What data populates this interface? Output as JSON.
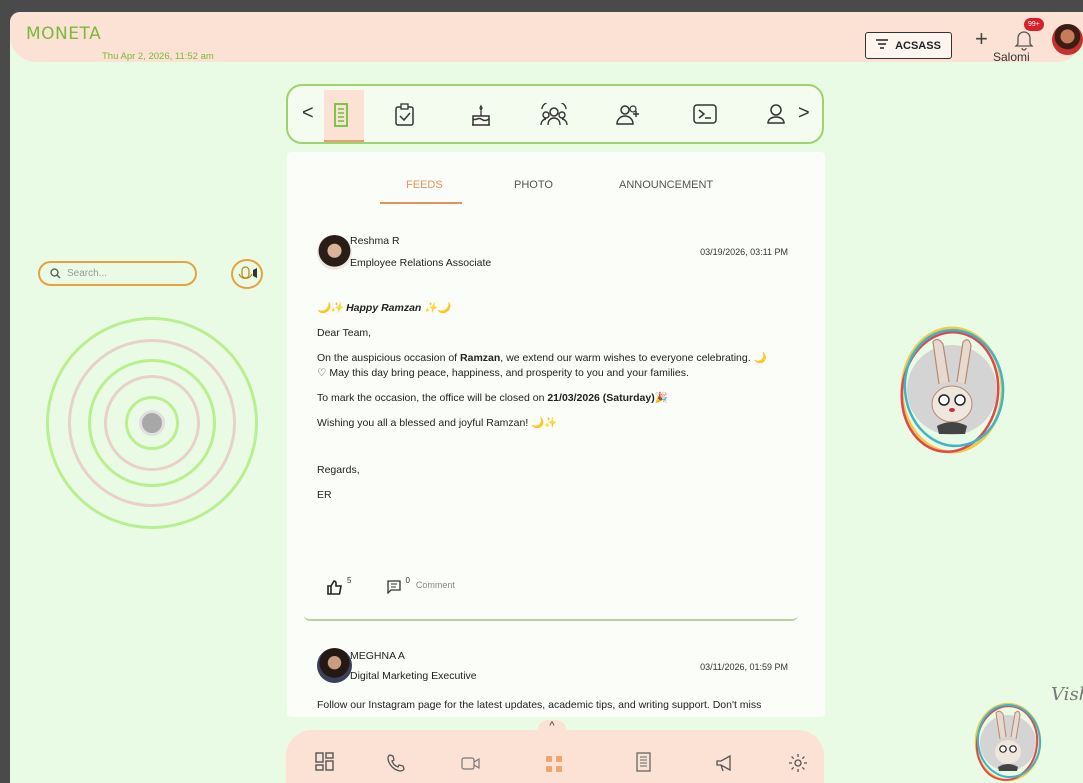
{
  "app": {
    "logo": "MONETA",
    "datetime": "Thu Apr 2, 2026, 11:52 am"
  },
  "header": {
    "filter_label": "ACSASS",
    "plus_icon": "plus-icon",
    "notification_count": "99+",
    "user_name": "Salomi"
  },
  "iconbar": {
    "prev": "<",
    "next": ">",
    "icons": [
      "feed-icon",
      "tasks-icon",
      "birthday-cake-icon",
      "team-icon",
      "add-user-icon",
      "terminal-icon",
      "profile-icon"
    ]
  },
  "tabs": [
    {
      "label": "FEEDS"
    },
    {
      "label": "PHOTO"
    },
    {
      "label": "ANNOUNCEMENT"
    }
  ],
  "posts": [
    {
      "author": "Reshma R",
      "role": "Employee Relations Associate",
      "date": "03/19/2026, 03:11 PM",
      "title": "🌙✨ Happy Ramzan ✨🌙",
      "greeting": "Dear Team,",
      "line1_pre": "On the auspicious occasion of ",
      "line1_bold": "Ramzan",
      "line1_post": ", we extend our warm wishes to everyone celebrating. 🌙",
      "line2": "♡ May this day bring peace, happiness, and prosperity to you and your families.",
      "line3_pre": "To mark the occasion, the office will be closed on ",
      "line3_bold": "21/03/2026 (Saturday)",
      "line3_post": "🎉",
      "line4": "Wishing you all a blessed and joyful Ramzan! 🌙✨",
      "regards": "Regards,",
      "sign": "ER",
      "likes": "5",
      "comments": "0",
      "comment_label": "Comment"
    },
    {
      "author": "MEGHNA A",
      "role": "Digital Marketing Executive",
      "date": "03/11/2026, 01:59 PM",
      "preview": "Follow our Instagram page for the latest updates, academic tips, and writing support. Don't miss"
    }
  ],
  "search": {
    "placeholder": "Search..."
  },
  "dock": {
    "icons": [
      "dashboard-icon",
      "phone-icon",
      "video-icon",
      "apps-icon",
      "document-icon",
      "megaphone-icon",
      "settings-icon"
    ]
  },
  "colors": {
    "accent": "#e8915e",
    "green": "#7cb83b",
    "background": "#eafbe5",
    "header": "#fbe2d4"
  }
}
